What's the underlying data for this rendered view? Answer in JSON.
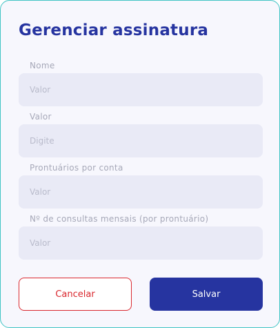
{
  "dialog": {
    "title": "Gerenciar assinatura",
    "fields": [
      {
        "label": "Nome",
        "value": "",
        "placeholder": "Valor"
      },
      {
        "label": "Valor",
        "value": "",
        "placeholder": "Digite"
      },
      {
        "label": "Prontuários por conta",
        "value": "",
        "placeholder": "Valor"
      },
      {
        "label": "Nº de consultas mensais (por prontuário)",
        "value": "",
        "placeholder": "Valor"
      }
    ],
    "buttons": {
      "cancel_label": "Cancelar",
      "save_label": "Salvar"
    }
  },
  "colors": {
    "accent": "#2634a0",
    "danger": "#d9252c",
    "border": "#3fc4c4"
  }
}
